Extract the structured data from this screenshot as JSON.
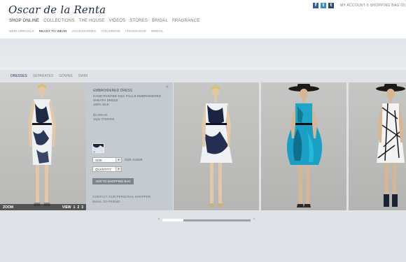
{
  "brand": {
    "logo": "Oscar de la Renta"
  },
  "account": {
    "my_account": "MY ACCOUNT",
    "shopping_bag": "0 SHOPPING BAG (0)"
  },
  "social": {
    "facebook": "f",
    "twitter": "t",
    "tumblr": "t"
  },
  "main_nav": [
    "SHOP ONLINE",
    "COLLECTIONS",
    "THE HOUSE",
    "VIDEOS",
    "STORES",
    "BRIDAL",
    "FRAGRANCE"
  ],
  "sub_nav": [
    "NEW ARRIVALS",
    "READY TO WEAR",
    "ACCESSORIES",
    "CHILDRENS",
    "FRAGRANCE",
    "BRIDAL"
  ],
  "category_nav": [
    "DRESSES",
    "SEPARATES",
    "GOWNS",
    "SWIM"
  ],
  "gallery": {
    "zoom_label": "ZOOM",
    "view_label": "VIEW",
    "views": [
      "1",
      "2",
      "3"
    ]
  },
  "product": {
    "title": "EMBROIDERED DRESS",
    "description_lines": [
      "HAND-PAINTED SILK FAILLE EMBROIDERED",
      "SHEATH DRESS",
      "100% SILK"
    ],
    "price": "$3,890.00",
    "style": "Style #TE8005",
    "size_label": "SIZE",
    "quantity_label": "QUANTITY",
    "size_guide": "SIZE GUIDE",
    "add_to_bag": "ADD TO SHOPPING BAG",
    "contact": "CONTACT OUR PERSONAL SHOPPER",
    "email": "EMAIL TO FRIEND"
  },
  "colors": {
    "accent": "#2a3a5a",
    "panel": "#c5cad0",
    "button": "#7e848c",
    "dress_teal": "#1fa3c4"
  },
  "scroll": {
    "position_fraction": 0.0
  }
}
